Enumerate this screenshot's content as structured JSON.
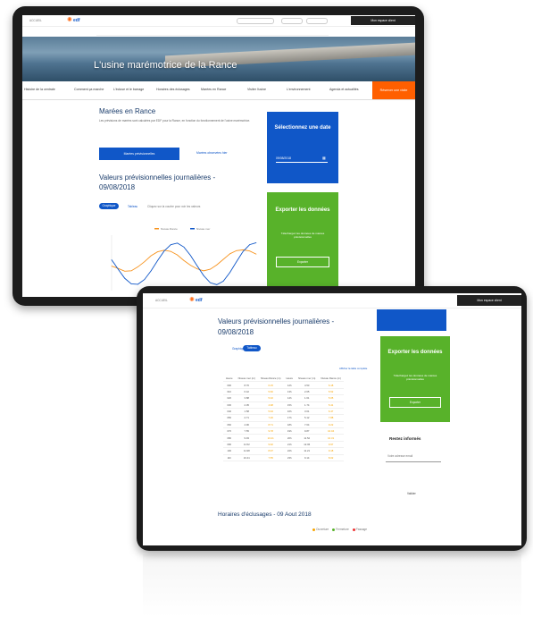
{
  "site": {
    "logo_text": "edf",
    "header_link": "ACCUEIL",
    "espace_label": "Mon espace client"
  },
  "hero": {
    "title": "L'usine marémotrice de la Rance"
  },
  "nav": {
    "items": [
      "Histoire de la centrale",
      "Comment ça marche",
      "L'écluse et le barrage",
      "Horaires des éclusages",
      "Marées en Rance",
      "Visiter l'usine",
      "L'environnement",
      "Agenda et actualités"
    ],
    "cta": "Réserver une visite"
  },
  "section": {
    "title": "Marées en Rance",
    "intro": "Les prévisions de marées sont calculées par EDF pour la Rance, en fonction du fonctionnement de l'usine marémotrice.",
    "btn_primary": "Marées prévisionnelles",
    "btn_secondary": "Marées observées hier",
    "daily_title": "Valeurs prévisionnelles journalières - 09/08/2018",
    "toggle_chart": "Graphique",
    "toggle_table": "Tableau",
    "chart_hint": "Cliquez sur la courbe pour voir les valeurs"
  },
  "cards": {
    "date_title": "Sélectionnez une date",
    "date_value": "09/08/2018",
    "export_title": "Exporter les données",
    "export_text": "Téléchargez les données de marées prévisionnelles",
    "export_btn": "Exporter"
  },
  "chart_data": {
    "type": "line",
    "series": [
      {
        "name": "Niveau Rance",
        "color": "#f7931e",
        "values": [
          6.2,
          5.6,
          4.9,
          5.0,
          6.0,
          7.3,
          8.8,
          9.8,
          10.2,
          9.9,
          9.0,
          7.6,
          6.4,
          5.5,
          5.0,
          5.4,
          6.5,
          7.9,
          9.3,
          10.1,
          10.3,
          10.0,
          9.2
        ]
      },
      {
        "name": "Niveau mer",
        "color": "#1057c8",
        "values": [
          7.8,
          5.4,
          3.1,
          1.7,
          1.6,
          2.8,
          5.0,
          7.6,
          10.0,
          11.6,
          12.0,
          11.0,
          8.9,
          6.3,
          3.8,
          2.0,
          1.5,
          2.4,
          4.6,
          7.3,
          9.9,
          11.6,
          12.1
        ]
      }
    ],
    "ylim": [
      0,
      14
    ],
    "grid": false
  },
  "second_screen": {
    "daily_title": "Valeurs prévisionnelles journalières - 09/08/2018",
    "table_note": "Afficher la table complète",
    "table": {
      "headers": [
        "Heure",
        "Niveau mer (m)",
        "Niveau Rance (m)",
        "Heure",
        "Niveau mer (m)",
        "Niveau Rance (m)"
      ],
      "rows": [
        [
          "00h",
          "8.76",
          "6.15",
          "12h",
          "4.53",
          "6.18"
        ],
        [
          "01h",
          "6.42",
          "5.60",
          "13h",
          "2.65",
          "5.52"
        ],
        [
          "02h",
          "3.88",
          "5.02",
          "14h",
          "1.61",
          "5.05"
        ],
        [
          "03h",
          "2.05",
          "4.98",
          "15h",
          "1.74",
          "5.41"
        ],
        [
          "04h",
          "1.58",
          "5.94",
          "16h",
          "3.01",
          "6.47"
        ],
        [
          "05h",
          "2.71",
          "7.26",
          "17h",
          "5.12",
          "7.88"
        ],
        [
          "06h",
          "4.96",
          "8.71",
          "18h",
          "7.64",
          "9.22"
        ],
        [
          "07h",
          "7.55",
          "9.78",
          "19h",
          "9.87",
          "10.04"
        ],
        [
          "08h",
          "9.93",
          "10.21",
          "20h",
          "11.52",
          "10.31"
        ],
        [
          "09h",
          "11.52",
          "9.92",
          "21h",
          "12.06",
          "9.97"
        ],
        [
          "10h",
          "11.98",
          "8.97",
          "22h",
          "11.21",
          "9.18"
        ],
        [
          "11h",
          "10.41",
          "7.55",
          "23h",
          "9.14",
          "8.02"
        ]
      ]
    },
    "eclusage_title": "Horaires d'éclusages - 09 Aout 2018",
    "eclusage_legend": [
      "Ouverture",
      "Fermeture",
      "Passage"
    ],
    "restez": "Restez informés",
    "restez_field": "Votre adresse email",
    "restez_btn": "Valider"
  },
  "colors": {
    "accent": "#1057c8",
    "orange": "#ff5f00",
    "green": "#58b22a"
  }
}
